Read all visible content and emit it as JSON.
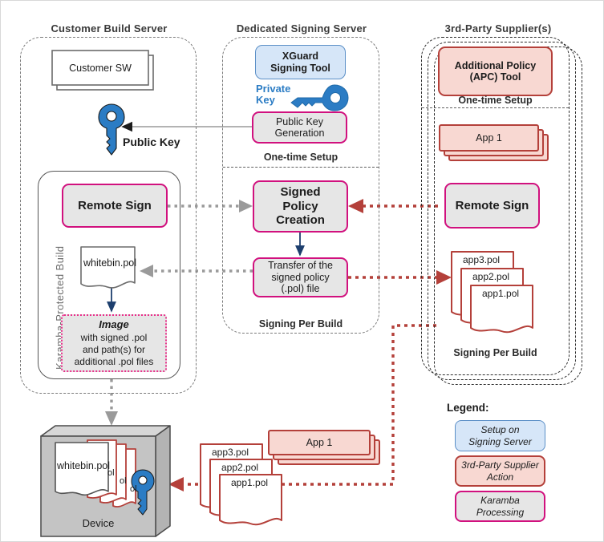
{
  "diagram": {
    "columns": [
      {
        "title": "Customer Build Server"
      },
      {
        "title": "Dedicated Signing Server"
      },
      {
        "title": "3rd-Party Supplier(s)"
      }
    ]
  },
  "customer": {
    "sw_box": "Customer SW",
    "public_key_label": "Public Key",
    "public_key_icon": "key-icon",
    "protected_build_label": "Karamba-Protected Build",
    "remote_sign": "Remote Sign",
    "whitebin_doc": "whitebin.pol",
    "image_box": {
      "title": "Image",
      "line1": "with signed .pol",
      "line2": "and path(s) for",
      "line3": "additional .pol files"
    }
  },
  "signing": {
    "xguard_tool": "XGuard\nSigning Tool",
    "xguard_tool_line1": "XGuard",
    "xguard_tool_line2": "Signing Tool",
    "private_key_line1": "Private",
    "private_key_line2": "Key",
    "private_key_icon": "key-icon",
    "public_key_generation_line1": "Public Key",
    "public_key_generation_line2": "Generation",
    "one_time_setup": "One-time Setup",
    "signed_policy_line1": "Signed",
    "signed_policy_line2": "Policy",
    "signed_policy_line3": "Creation",
    "transfer_line1": "Transfer of the",
    "transfer_line2": "signed policy",
    "transfer_line3": "(.pol) file",
    "signing_per_build": "Signing Per Build"
  },
  "supplier": {
    "apc_tool_line1": "Additional Policy",
    "apc_tool_line2": "(APC) Tool",
    "one_time_setup": "One-time Setup",
    "app_box": "App 1",
    "remote_sign": "Remote Sign",
    "pol_stack": [
      "app3.pol",
      "app2.pol",
      "app1.pol"
    ],
    "signing_per_build": "Signing Per Build"
  },
  "device": {
    "label": "Device",
    "whitebin_doc": "whitebin.pol",
    "stacked_doc_fragments": [
      "ol",
      "ol",
      "ol"
    ],
    "key_icon": "key-icon"
  },
  "bottom": {
    "app_box": "App 1",
    "pol_stack": [
      "app3.pol",
      "app2.pol",
      "app1.pol"
    ]
  },
  "legend": {
    "title": "Legend:",
    "items": [
      {
        "line1": "Setup on",
        "line2": "Signing Server",
        "color": "#d6e6f8"
      },
      {
        "line1": "3rd-Party Supplier",
        "line2": "Action",
        "color": "#f8d8d2"
      },
      {
        "line1": "Karamba",
        "line2": "Processing",
        "color": "#e6e6e6"
      }
    ]
  },
  "colors": {
    "karamba_magenta": "#d1117e",
    "supplier_red": "#b4403a",
    "signing_blue": "#5b8fc7",
    "key_blue": "#2b7cc4",
    "arrow_gray": "#9a9a9a",
    "arrow_navy": "#1d3f6e"
  }
}
